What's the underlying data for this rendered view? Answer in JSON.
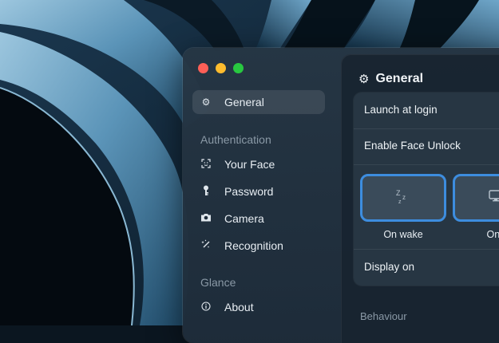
{
  "window": {
    "controls": [
      "close",
      "minimize",
      "maximize"
    ]
  },
  "sidebar": {
    "items": [
      {
        "id": "general",
        "label": "General",
        "icon": "gear-icon",
        "selected": true
      },
      {
        "id": "your-face",
        "label": "Your Face",
        "icon": "face-scan-icon"
      },
      {
        "id": "password",
        "label": "Password",
        "icon": "key-icon"
      },
      {
        "id": "camera",
        "label": "Camera",
        "icon": "camera-icon"
      },
      {
        "id": "recognition",
        "label": "Recognition",
        "icon": "sparkle-wand-icon"
      },
      {
        "id": "about",
        "label": "About",
        "icon": "info-icon"
      }
    ],
    "sections": {
      "authentication": "Authentication",
      "glance": "Glance"
    }
  },
  "content": {
    "title": "General",
    "title_icon": "gear-icon",
    "rows": {
      "launch_at_login": "Launch at login",
      "enable_face_unlock": "Enable Face Unlock",
      "display_on": "Display on"
    },
    "tiles": [
      {
        "label": "On wake",
        "icon": "sleep-zzz-icon",
        "selected": true
      },
      {
        "label": "On l",
        "icon": "display-icon",
        "selected": true
      }
    ],
    "behaviour_label": "Behaviour"
  },
  "colors": {
    "accent": "#3d8ddf",
    "close": "#fe5f57",
    "minimize": "#febc2e",
    "maximize": "#28c840"
  }
}
